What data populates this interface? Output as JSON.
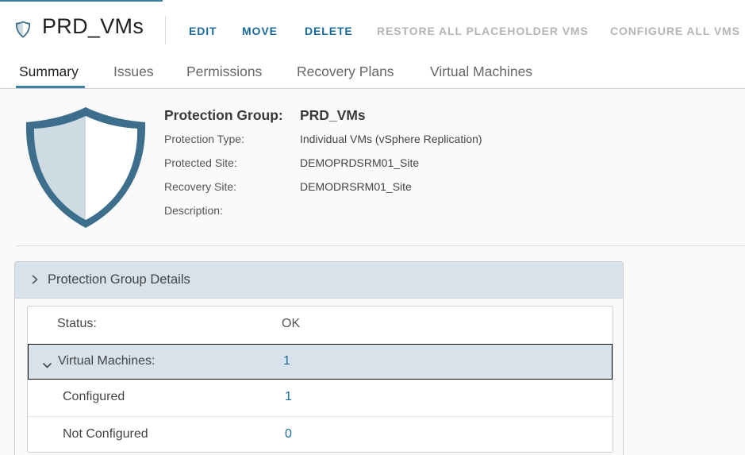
{
  "header": {
    "title": "PRD_VMs",
    "icon": "shield-icon",
    "actions": [
      {
        "label": "EDIT",
        "enabled": true
      },
      {
        "label": "MOVE",
        "enabled": true
      },
      {
        "label": "DELETE",
        "enabled": true
      },
      {
        "label": "RESTORE ALL PLACEHOLDER VMS",
        "enabled": false
      },
      {
        "label": "CONFIGURE ALL VMS",
        "enabled": false
      }
    ]
  },
  "tabs": [
    {
      "label": "Summary",
      "active": true
    },
    {
      "label": "Issues",
      "active": false
    },
    {
      "label": "Permissions",
      "active": false
    },
    {
      "label": "Recovery Plans",
      "active": false
    },
    {
      "label": "Virtual Machines",
      "active": false
    }
  ],
  "summary": {
    "heading_label": "Protection Group:",
    "heading_value": "PRD_VMs",
    "properties": [
      {
        "label": "Protection Type:",
        "value": "Individual VMs (vSphere Replication)"
      },
      {
        "label": "Protected Site:",
        "value": "DEMOPRDSRM01_Site"
      },
      {
        "label": "Recovery Site:",
        "value": "DEMODRSRM01_Site"
      },
      {
        "label": "Description:",
        "value": ""
      }
    ]
  },
  "details": {
    "title": "Protection Group Details",
    "rows": [
      {
        "label": "Status:",
        "value": "OK"
      },
      {
        "label": "Virtual Machines:",
        "value": "1"
      },
      {
        "label": "Configured",
        "value": "1"
      },
      {
        "label": "Not Configured",
        "value": "0"
      }
    ]
  },
  "colors": {
    "accent": "#1a6a9a",
    "shield_outline": "#3d6e8c",
    "shield_fill": "#cfdbe3",
    "selected_row": "#d8e2ea"
  }
}
